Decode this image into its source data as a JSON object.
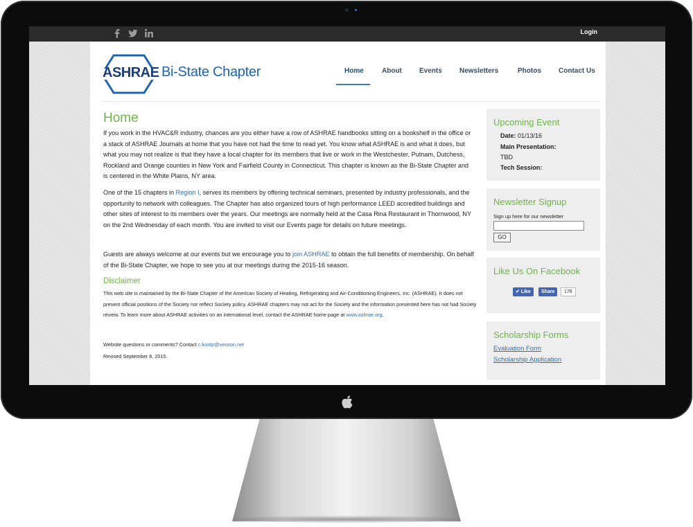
{
  "topbar": {
    "social_icons": [
      "facebook-icon",
      "twitter-icon",
      "linkedin-icon"
    ],
    "login": "Login"
  },
  "header": {
    "logo_text": "ASHRAE",
    "chapter_text": "Bi-State Chapter",
    "nav": [
      "Home",
      "About",
      "Events",
      "Newsletters",
      "Photos",
      "Contact Us"
    ],
    "active_nav": "Home"
  },
  "main": {
    "heading": "Home",
    "p1": "If you work in the HVAC&R industry, chances are you either have a row of ASHRAE handbooks sitting on a bookshelf in the office or a stack of ASHRAE Journals at home that you have not had the time to read yet. You know what ASHRAE is and what it does, but what you may not realize is that they have a local chapter for its members that live or work in the Westchester, Putnam, Dutchess, Rockland and Orange counties in New York and Fairfield County in Connecticut. This chapter is known as the Bi-State Chapter and is centered in the White Plains, NY area.",
    "p2_before": "One of the 15 chapters in ",
    "p2_link": "Region I",
    "p2_after": ", serves its members by offering technical seminars, presented by industry professionals, and the opportunity to network with colleagues. The Chapter has also organized tours of high performance LEED accredited buildings and other sites of interest to its members over the years. Our meetings are normally held at the Casa Rina Restaurant in Thornwood, NY on the 2nd Wednesday of each month. You are invited to visit our Events page for details on future meetings.",
    "p3_before": "Guests are always welcome at our events but we encourage you to ",
    "p3_link": "join ASHRAE",
    "p3_after": " to obtain the full benefits of membership. On behalf of the Bi-State Chapter, we hope to see you at our meetings during the 2015-16 season.",
    "disclaimer_heading": "Disclaimer",
    "disclaimer_text": "This web site is maintained by the Bi-State Chapter of the American Society of Heating, Refrigerating and Air-Conditioning Engineers, Inc. (ASHRAE). It does not present official positions of the Society nor reflect Society policy. ASHRAE chapters may not act for the Society and the information presented here has not had Society review. To learn more about ASHRAE activities on an international level, contact the ASHRAE home page at ",
    "disclaimer_link": "www.ashrae.org",
    "disclaimer_end": ".",
    "contact_before": "Website questions or comments? Contact ",
    "contact_link": "c.koritz@verizon.net",
    "revised": "Revised September 8, 2015."
  },
  "sidebar": {
    "event": {
      "title": "Upcoming Event",
      "date_label": "Date:",
      "date_value": "01/13/16",
      "main_label": "Main Presentation:",
      "main_value": "TBD",
      "tech_label": "Tech Session:"
    },
    "newsletter": {
      "title": "Newsletter Signup",
      "label": "Sign up here for our newsletter",
      "input_value": "",
      "button": "GO"
    },
    "facebook": {
      "title": "Like Us On Facebook",
      "like": "Like",
      "share": "Share",
      "count": "178"
    },
    "scholarship": {
      "title": "Scholarship Forms",
      "links": [
        "Evaluation Form",
        "Scholarship Application"
      ]
    }
  },
  "colors": {
    "accent_green": "#6cb548",
    "link_blue": "#2f6db3",
    "logo_navy": "#1b3d7b",
    "facebook_blue": "#4267b2"
  }
}
